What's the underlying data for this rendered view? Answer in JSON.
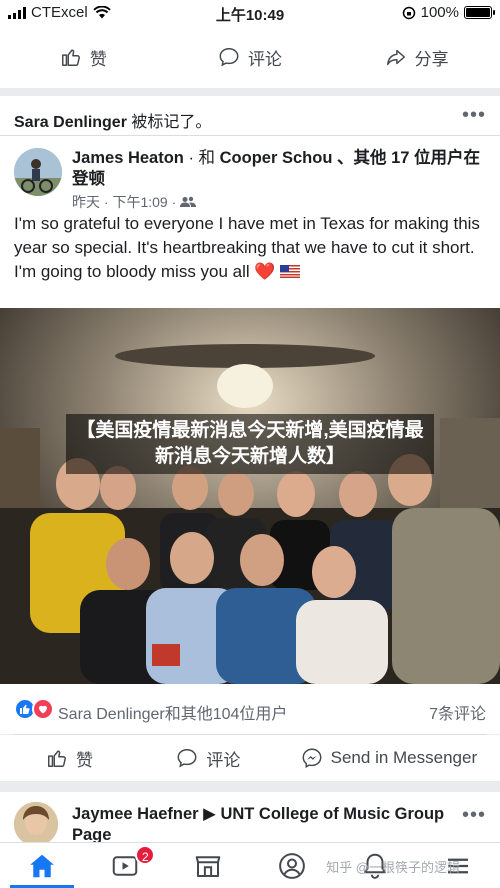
{
  "status_bar": {
    "carrier": "CTExcel",
    "time": "上午10:49",
    "battery": "100%",
    "battery_level": 1.0
  },
  "top_actions": {
    "like_label": "赞",
    "comment_label": "评论",
    "share_label": "分享"
  },
  "post": {
    "tag_name": "Sara Denlinger",
    "tag_suffix": " 被标记了。",
    "author_main": "James Heaton",
    "author_sep": " · 和 ",
    "author_with": "Cooper Schou",
    "author_rest": " 、其他 17 位用户在登顿",
    "date": "昨天 · 下午1:09 ·",
    "text_before_heart": "I'm so grateful to everyone I have met in Texas for making this year so special. It's heartbreaking that we have to cut it short. I'm going to bloody miss you all ",
    "heart": "❤️",
    "photo_caption": "【美国疫情最新消息今天新增,美国疫情最新消息今天新增人数】",
    "reactions_text": "Sara Denlinger和其他104位用户",
    "comments_count": "7条评论",
    "like_label": "赞",
    "comment_label": "评论",
    "messenger_label": "Send in Messenger"
  },
  "next_post": {
    "author_main": "Jaymee Haefner",
    "arrow": " ▶ ",
    "group": "UNT College of Music Group Page"
  },
  "tab_bar": {
    "video_badge": "2",
    "watermark": "知乎 @一根筷子的逻辑"
  },
  "colors": {
    "brand_blue": "#1877f2",
    "love_red": "#f33e58",
    "badge_red": "#e41e3f"
  },
  "icons": [
    "wifi-icon",
    "like-icon",
    "comment-icon",
    "share-icon",
    "more-icon",
    "friends-icon",
    "messenger-icon",
    "home-icon",
    "video-icon",
    "marketplace-icon",
    "profile-icon",
    "bell-icon"
  ]
}
